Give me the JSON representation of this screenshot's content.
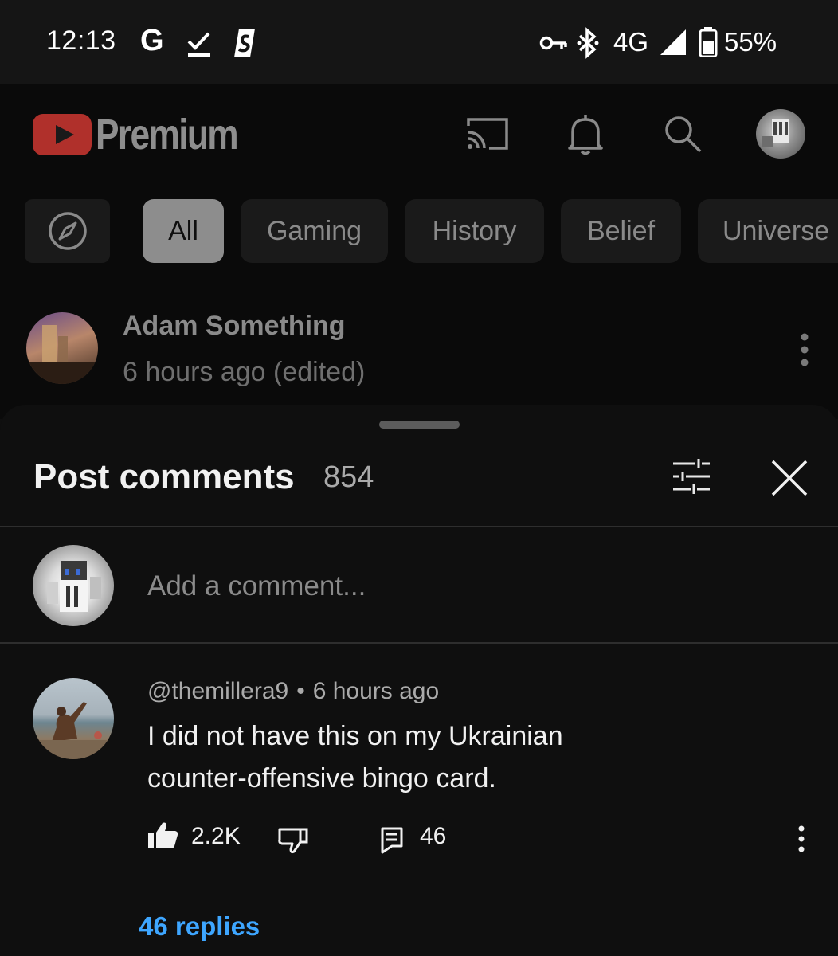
{
  "status_bar": {
    "time": "12:13",
    "g_label": "G",
    "network": "4G",
    "battery": "55%",
    "icons": [
      "google-icon",
      "check-download-icon",
      "app-s-icon",
      "vpn-key-icon",
      "bluetooth-icon",
      "signal-icon",
      "battery-icon"
    ]
  },
  "header": {
    "brand": "Premium",
    "icons": [
      "cast-icon",
      "bell-icon",
      "search-icon",
      "avatar"
    ]
  },
  "chips": [
    {
      "label": "All",
      "selected": true
    },
    {
      "label": "Gaming",
      "selected": false
    },
    {
      "label": "History",
      "selected": false
    },
    {
      "label": "Belief",
      "selected": false
    },
    {
      "label": "Universe",
      "selected": false
    }
  ],
  "post": {
    "channel": "Adam Something",
    "time": "6 hours ago (edited)"
  },
  "sheet": {
    "title": "Post comments",
    "count": "854",
    "add_comment_placeholder": "Add a comment..."
  },
  "comment": {
    "author": "@themillera9",
    "separator": "•",
    "time": "6 hours ago",
    "text": "I did not have this on my Ukrainian counter-offensive bingo card.",
    "likes": "2.2K",
    "reply_count": "46",
    "replies_link": "46 replies"
  },
  "colors": {
    "background": "#0f0f0f",
    "youtube_red": "#c4302b",
    "link_blue": "#3ea6ff",
    "chip_selected": "#8d8d8d"
  }
}
